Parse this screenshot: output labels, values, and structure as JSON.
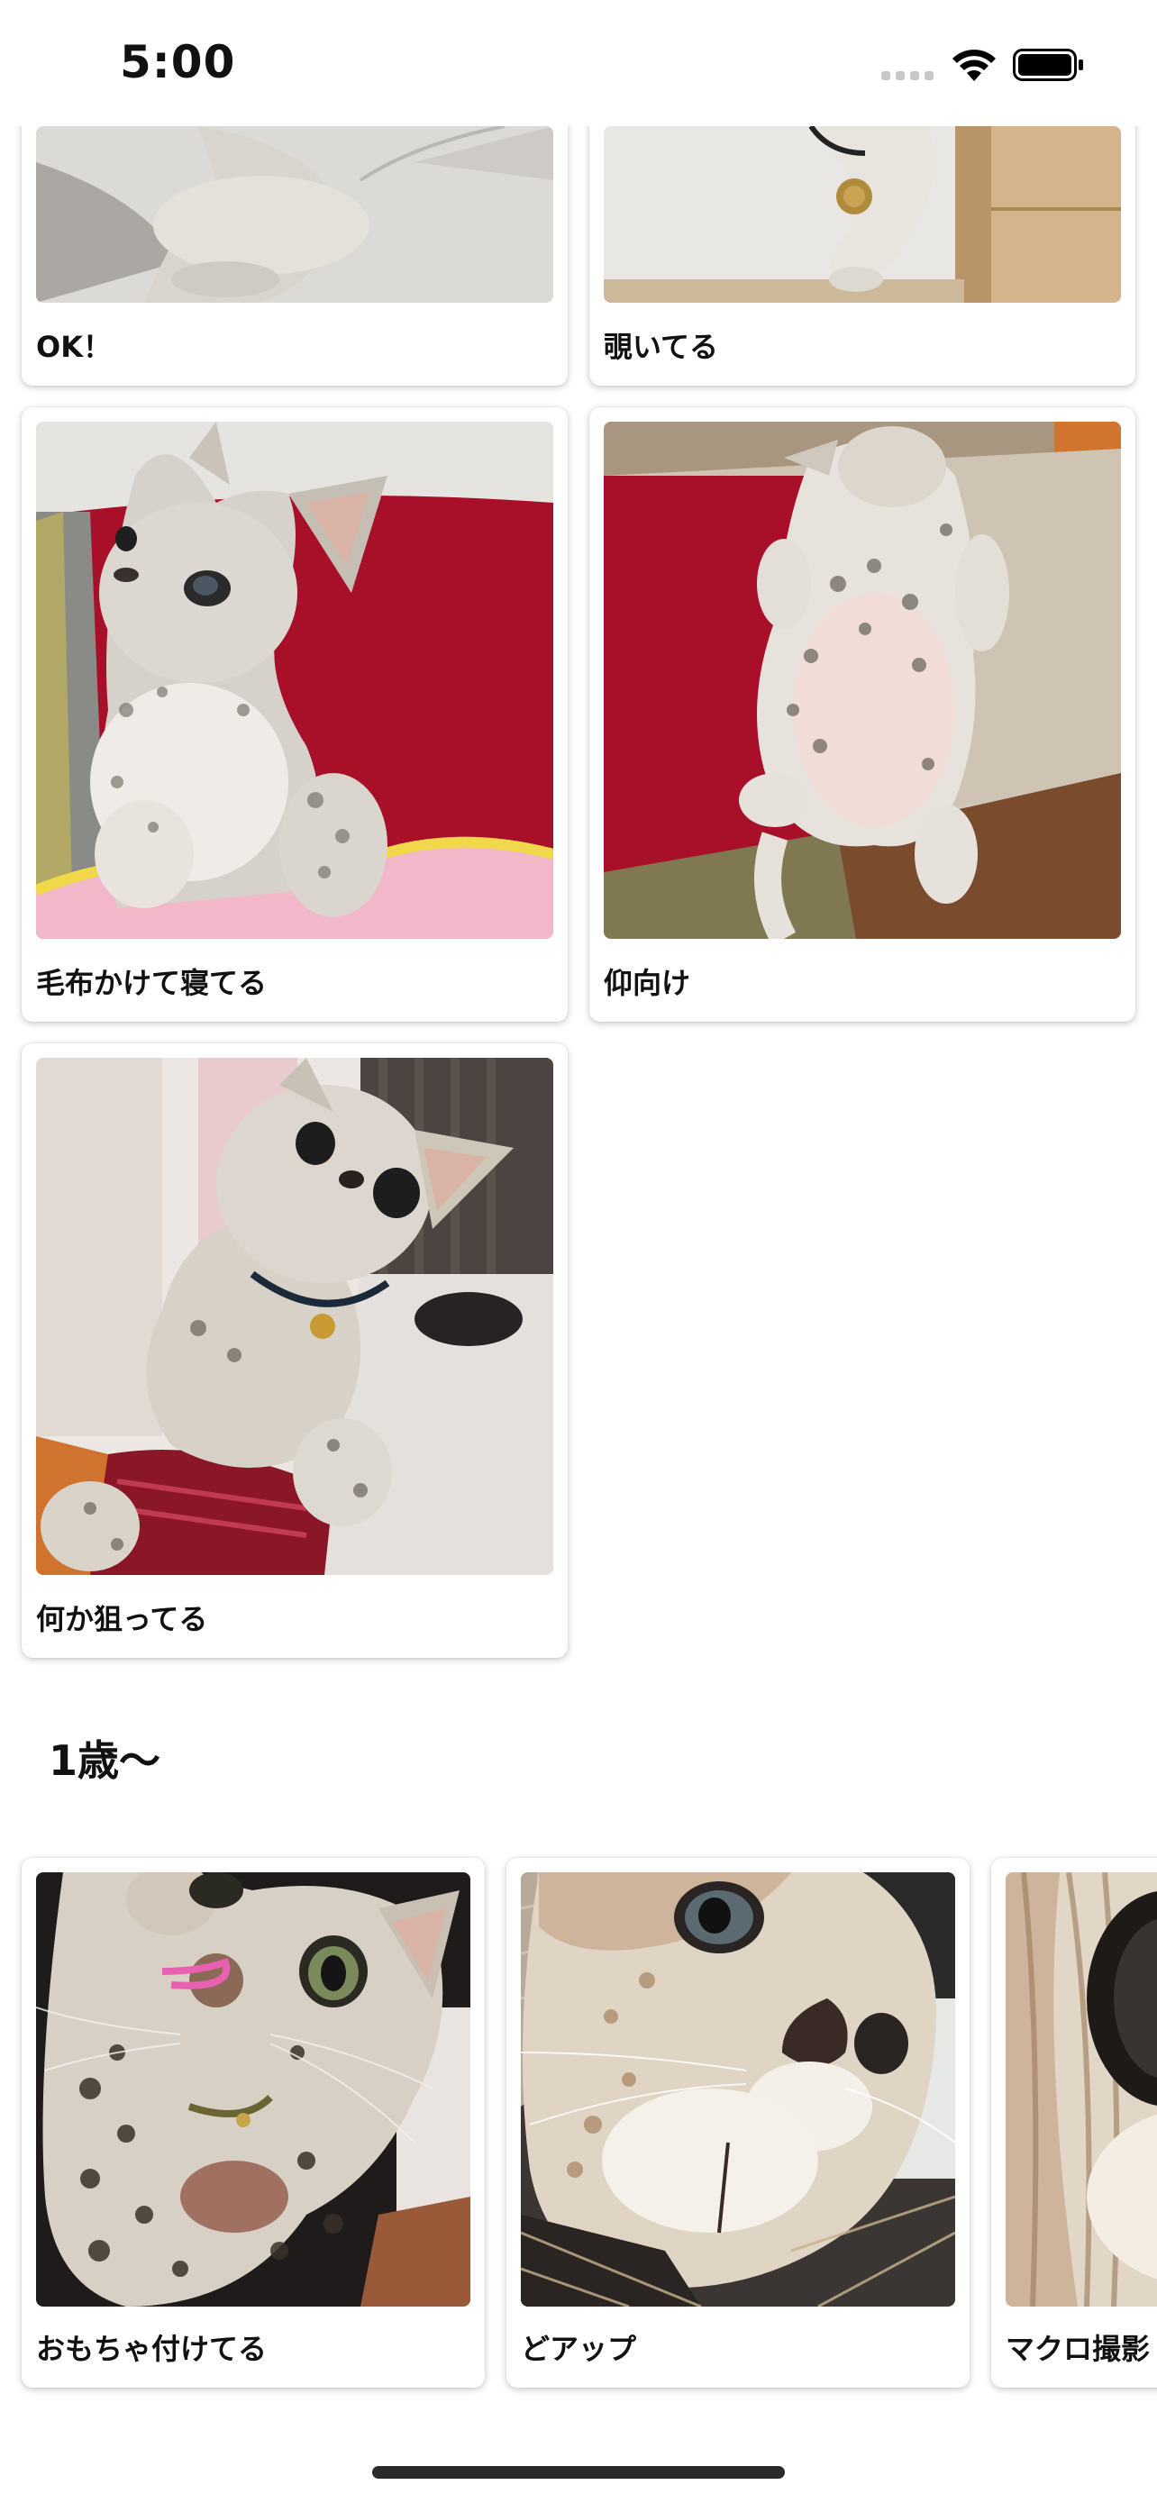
{
  "status_bar": {
    "time": "5:00"
  },
  "grid_cards": [
    {
      "caption": "OK！",
      "icon": "photo-cat-walking"
    },
    {
      "caption": "覗いてる",
      "icon": "photo-cat-peeking"
    },
    {
      "caption": "毛布かけて寝てる",
      "icon": "photo-cat-on-sofa"
    },
    {
      "caption": "仰向け",
      "icon": "photo-cat-on-back"
    },
    {
      "caption": "何か狙ってる",
      "icon": "photo-cat-looking-up"
    }
  ],
  "section": {
    "title": "1歳〜"
  },
  "carousel_cards": [
    {
      "caption": "おもちゃ付けてる",
      "icon": "photo-cat-with-toy"
    },
    {
      "caption": "どアップ",
      "icon": "photo-cat-closeup"
    },
    {
      "caption": "マクロ撮影",
      "icon": "photo-cat-macro"
    }
  ],
  "colors": {
    "background": "#ffffff",
    "card_shadow": "rgba(0,0,0,0.22)",
    "text": "#111111",
    "sofa_red": "#a8102a",
    "cat_fur": "#cfcac3"
  }
}
